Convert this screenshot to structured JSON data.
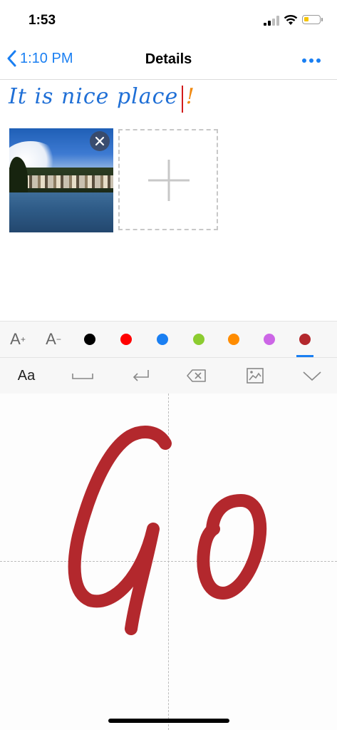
{
  "status_bar": {
    "time": "1:53"
  },
  "nav": {
    "back_label": "1:10 PM",
    "title": "Details"
  },
  "note": {
    "text": "It is nice place",
    "exclamation": "!",
    "text_color": "#1f6fd6",
    "exclamation_color": "#f08a12"
  },
  "attachments": {
    "photo_description": "lake-photo"
  },
  "toolbar": {
    "font_increase": "A",
    "font_increase_sup": "+",
    "font_decrease": "A",
    "font_decrease_sup": "−",
    "colors": [
      "#000000",
      "#ff0000",
      "#1a7ff2",
      "#8ccc30",
      "#ff8c00",
      "#cc66e6",
      "#b3282d"
    ],
    "selected_color": "#b3282d",
    "input_mode_label": "Aa"
  },
  "canvas": {
    "ink_color": "#b3282d"
  }
}
